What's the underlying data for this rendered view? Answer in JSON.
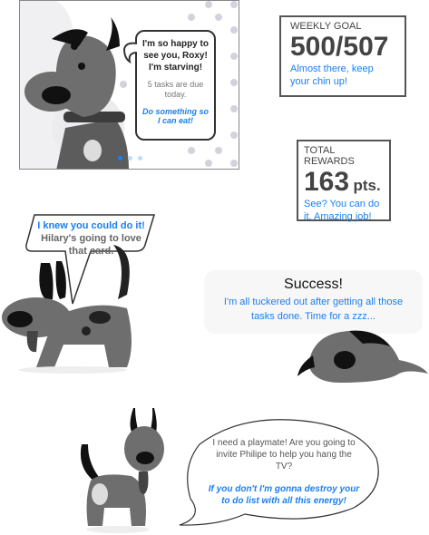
{
  "card": {
    "bubble_line1": "I'm so happy to see you, Roxy! I'm starving!",
    "bubble_line2": "5 tasks are due today.",
    "bubble_line3": "Do something so I can eat!",
    "pager": {
      "count": 3,
      "active": 1
    }
  },
  "weekly_goal": {
    "label": "WEEKLY GOAL",
    "value": "500/507",
    "message": "Almost there, keep your chin up!"
  },
  "total_rewards": {
    "label": "TOTAL REWARDS",
    "value": "163",
    "unit": "pts.",
    "message": "See? You can do it. Amazing job!"
  },
  "card_bubble_2": {
    "highlight": "I knew you could do it!",
    "text": " Hilary's going to love that card."
  },
  "success": {
    "title": "Success!",
    "message": "I'm all tuckered out after getting all those tasks done. Time for a zzz..."
  },
  "playmate_bubble": {
    "text": "I need a playmate! Are you going to invite Philipe to help you hang the TV?",
    "highlight": "If you don't I'm gonna destroy your to do list with all this energy!"
  },
  "colors": {
    "accent": "#1a7ff0",
    "dog": "#6b6b6b",
    "dark": "#111111"
  }
}
